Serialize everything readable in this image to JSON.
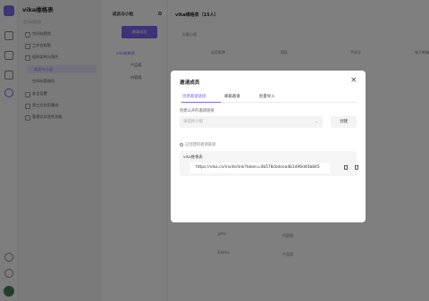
{
  "app": {
    "space_name": "vika维格表",
    "section_label": "空间站管理"
  },
  "sidebar": {
    "items": [
      {
        "label": "空间站预览"
      },
      {
        "label": "工作台权限"
      },
      {
        "label": "组织架构与角色"
      },
      {
        "label": "成员与小组"
      },
      {
        "label": "空间站管理员"
      },
      {
        "label": "安全设置"
      },
      {
        "label": "第三方应用集成"
      },
      {
        "label": "管理员实验性功能"
      }
    ]
  },
  "panel": {
    "title": "成员与小组",
    "invite_button": "邀请成员",
    "root": "vika维格表",
    "teams": [
      "产品组",
      "内容组"
    ]
  },
  "main": {
    "title": "vika维格表（15人）",
    "subtitle": "分配小组",
    "columns": [
      "成员昵称",
      "团队",
      "手机号",
      "电子邮箱"
    ],
    "rows": [
      {
        "team": "内容组"
      },
      {
        "team": "产品组"
      }
    ],
    "row_names": [
      "pmo",
      "Emma"
    ]
  },
  "modal": {
    "title": "邀请成员",
    "close_glyph": "×",
    "tabs": [
      {
        "label": "创建邀请链接"
      },
      {
        "label": "邮箱邀请"
      },
      {
        "label": "批量导入"
      }
    ],
    "create_label": "创建公开的邀请链接",
    "select_placeholder": "请选择小组",
    "select_chevron": "⌄",
    "create_button": "创建",
    "created_label": "已创建的邀请链接",
    "link_card": {
      "name": "vika维格表",
      "url": "https://vika.cn/invite/link?token=4b578cbdcea4b1496d44b845"
    }
  },
  "colors": {
    "accent": "#7b67ee"
  }
}
